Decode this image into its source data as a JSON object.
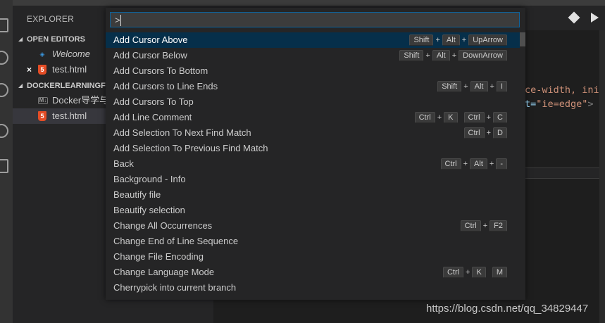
{
  "sidebar": {
    "title": "EXPLORER",
    "open_editors_label": "OPEN EDITORS",
    "open_editors": [
      {
        "name": "Welcome",
        "icon": "vscode-icon",
        "italic": true
      },
      {
        "name": "test.html",
        "icon": "html5-icon",
        "dirty_close": "×"
      }
    ],
    "folder_label": "DOCKERLEARNINGF",
    "folder_items": [
      {
        "name": "Docker导学与",
        "icon": "markdown-icon",
        "badge": "M↓"
      },
      {
        "name": "test.html",
        "icon": "html5-icon",
        "badge": "5"
      }
    ],
    "vs_badge": "◈",
    "h5_badge": "5"
  },
  "editor": {
    "code_line1": "ce-width, init",
    "code_line2_attr": "t=",
    "code_line2_val": "\"ie=edge\"",
    "code_line2_end": ">"
  },
  "palette": {
    "input_value": ">",
    "items": [
      {
        "label": "Add Cursor Above",
        "keys": [
          "Shift",
          "Alt",
          "UpArrow"
        ],
        "active": true
      },
      {
        "label": "Add Cursor Below",
        "keys": [
          "Shift",
          "Alt",
          "DownArrow"
        ]
      },
      {
        "label": "Add Cursors To Bottom",
        "keys": []
      },
      {
        "label": "Add Cursors to Line Ends",
        "keys": [
          "Shift",
          "Alt",
          "I"
        ]
      },
      {
        "label": "Add Cursors To Top",
        "keys": []
      },
      {
        "label": "Add Line Comment",
        "keys": [
          "Ctrl",
          "K"
        ],
        "keys2": [
          "Ctrl",
          "C"
        ]
      },
      {
        "label": "Add Selection To Next Find Match",
        "keys": [
          "Ctrl",
          "D"
        ]
      },
      {
        "label": "Add Selection To Previous Find Match",
        "keys": []
      },
      {
        "label": "Back",
        "keys": [
          "Ctrl",
          "Alt",
          "-"
        ]
      },
      {
        "label": "Background - Info",
        "keys": []
      },
      {
        "label": "Beautify file",
        "keys": []
      },
      {
        "label": "Beautify selection",
        "keys": []
      },
      {
        "label": "Change All Occurrences",
        "keys": [
          "Ctrl",
          "F2"
        ]
      },
      {
        "label": "Change End of Line Sequence",
        "keys": []
      },
      {
        "label": "Change File Encoding",
        "keys": []
      },
      {
        "label": "Change Language Mode",
        "keys": [
          "Ctrl",
          "K"
        ],
        "keys2": [
          "M"
        ]
      },
      {
        "label": "Cherrypick into current branch",
        "keys": []
      }
    ]
  },
  "watermark": "https://blog.csdn.net/qq_34829447",
  "colors": {
    "accent": "#0e639c",
    "active_row": "#062f4a",
    "html5": "#e44d26",
    "vscode_blue": "#3a96dd"
  }
}
